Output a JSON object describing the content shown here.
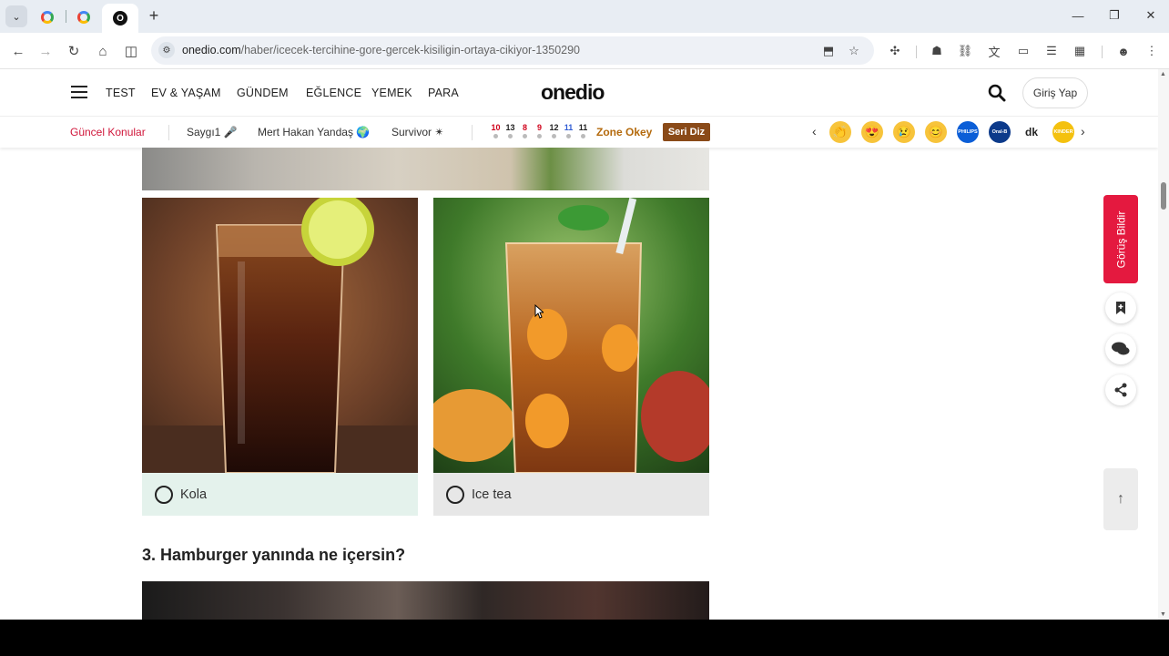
{
  "browser": {
    "url_host": "onedio.com",
    "url_path": "/haber/icecek-tercihine-gore-gercek-kisiligin-ortaya-cikiyor-1350290",
    "new_tab_label": "+",
    "win_min": "—",
    "win_restore": "❐",
    "win_close": "✕"
  },
  "site": {
    "logo": "onedio",
    "nav": [
      "TEST",
      "EV & YAŞAM",
      "GÜNDEM",
      "EĞLENCE",
      "YEMEK",
      "PARA"
    ],
    "login_label": "Giriş Yap"
  },
  "subbar": {
    "title": "Güncel Konular",
    "topics": [
      "Saygı1 🎤",
      "Mert Hakan Yandaş 🌍",
      "Survivor ✴"
    ],
    "numbers": [
      "10",
      "13",
      "8",
      "9",
      "12",
      "11",
      "11"
    ],
    "number_colors": [
      "#d0021b",
      "#222222",
      "#d0021b",
      "#d0021b",
      "#222222",
      "#2f5bd3",
      "#222222"
    ],
    "zone_label": "Zone Okey",
    "seri_label": "Seri Diz",
    "prev": "‹",
    "next": "›",
    "brands": [
      {
        "name": "hand",
        "glyph": "👏",
        "bg": "#f7c43b"
      },
      {
        "name": "love",
        "glyph": "😍",
        "bg": "#f7c43b"
      },
      {
        "name": "sad",
        "glyph": "😢",
        "bg": "#f7c43b"
      },
      {
        "name": "happy",
        "glyph": "😊",
        "bg": "#f7c43b"
      },
      {
        "name": "philips",
        "glyph": "PHILIPS",
        "bg": "#0b5ed7"
      },
      {
        "name": "oralb",
        "glyph": "Oral-B",
        "bg": "#0c3a8a"
      },
      {
        "name": "dk",
        "glyph": "dk",
        "bg": "#ffffff"
      },
      {
        "name": "bonus",
        "glyph": "KINDER",
        "bg": "#f4c10f"
      }
    ]
  },
  "quiz": {
    "options": [
      {
        "label": "Kola"
      },
      {
        "label": "Ice tea"
      }
    ],
    "question": "3. Hamburger yanında ne içersin?"
  },
  "rail": {
    "feedback_label": "Görüş Bildir",
    "to_top": "↑"
  }
}
